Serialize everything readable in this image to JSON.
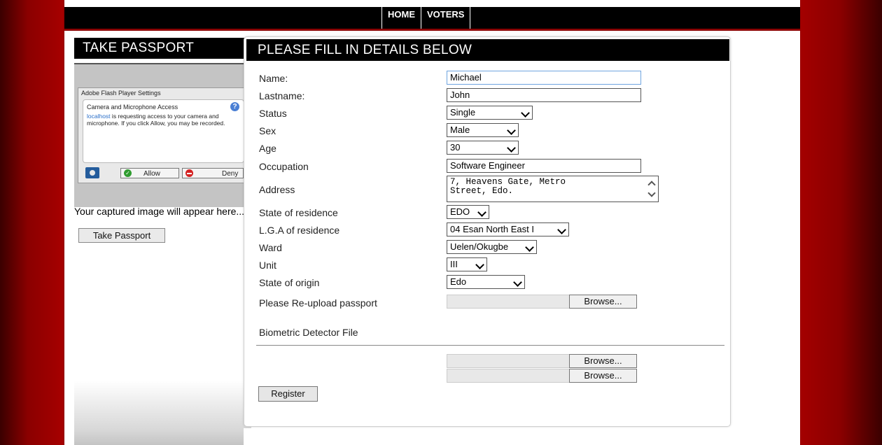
{
  "nav": {
    "home": "HOME",
    "voters": "VOTERS"
  },
  "left": {
    "title": "TAKE PASSPORT",
    "flash": {
      "title": "Adobe Flash Player Settings",
      "heading": "Camera and Microphone Access",
      "help": "?",
      "link": "localhost",
      "message": " is requesting access to your camera and microphone. If you click Allow, you may be recorded.",
      "allow": "Allow",
      "deny": "Deny"
    },
    "capture_text": "Your captured image will appear here...",
    "take_button": "Take Passport"
  },
  "form": {
    "title": "PLEASE FILL IN DETAILS BELOW",
    "name_label": "Name:",
    "name_value": "Michael",
    "lastname_label": "Lastname:",
    "lastname_value": "John",
    "status_label": "Status",
    "status_value": "Single",
    "sex_label": "Sex",
    "sex_value": "Male",
    "age_label": "Age",
    "age_value": "30",
    "occupation_label": "Occupation",
    "occupation_value": "Software Engineer",
    "address_label": "Address",
    "address_line1": "7, Heavens Gate, Metro",
    "address_line2": "Street, Edo.",
    "state_res_label": "State of residence",
    "state_res_value": "EDO",
    "lga_label": "L.G.A of residence",
    "lga_value": "04 Esan North East I",
    "ward_label": "Ward",
    "ward_value": "Uelen/Okugbe",
    "unit_label": "Unit",
    "unit_value": "III",
    "origin_label": "State of origin",
    "origin_value": "Edo",
    "passport_label": "Please Re-upload passport",
    "browse": "Browse...",
    "biometric_label": "Biometric Detector File",
    "register": "Register"
  }
}
